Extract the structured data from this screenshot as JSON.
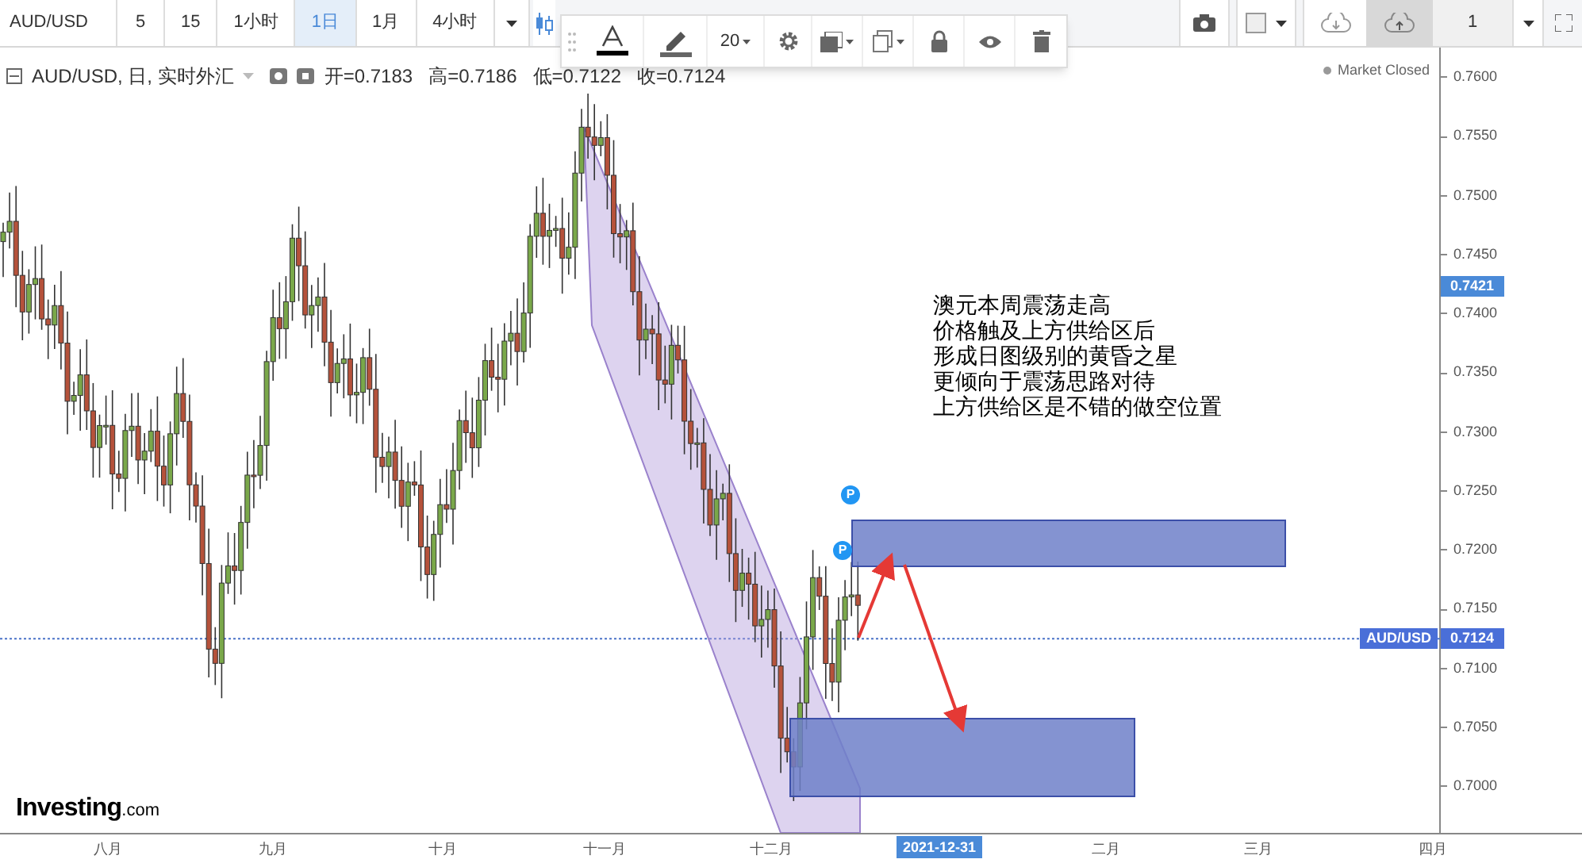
{
  "toolbar": {
    "symbol": "AUD/USD",
    "intervals": [
      {
        "label": "5",
        "selected": false
      },
      {
        "label": "15",
        "selected": false
      },
      {
        "label": "1小时",
        "selected": false
      },
      {
        "label": "1日",
        "selected": true
      },
      {
        "label": "1月",
        "selected": false
      },
      {
        "label": "4小时",
        "selected": false
      }
    ],
    "layout_count": "1"
  },
  "drawing_toolbar": {
    "font_size": "20"
  },
  "legend": {
    "title": "AUD/USD, 日, 实时外汇",
    "open": "开=0.7183",
    "high": "高=0.7186",
    "low": "低=0.7122",
    "close": "收=0.7124",
    "market_status": "Market Closed"
  },
  "annotation": [
    "澳元本周震荡走高",
    "价格触及上方供给区后",
    "形成日图级别的黄昏之星",
    "更倾向于震荡思路对待",
    "上方供给区是不错的做空位置"
  ],
  "markers": [
    "P",
    "P"
  ],
  "price_axis": {
    "ticks": [
      "0.7600",
      "0.7550",
      "0.7500",
      "0.7450",
      "0.7400",
      "0.7350",
      "0.7300",
      "0.7250",
      "0.7200",
      "0.7150",
      "0.7100",
      "0.7050",
      "0.7000"
    ],
    "crosshair_price": "0.7421",
    "symbol_label": "AUD/USD",
    "last_price": "0.7124"
  },
  "time_axis": {
    "ticks": [
      "八月",
      "九月",
      "十月",
      "十一月",
      "十二月",
      "二月",
      "三月",
      "四月"
    ],
    "crosshair_date": "2021-12-31"
  },
  "logo": {
    "brand": "Investing",
    "suffix": ".com"
  }
}
